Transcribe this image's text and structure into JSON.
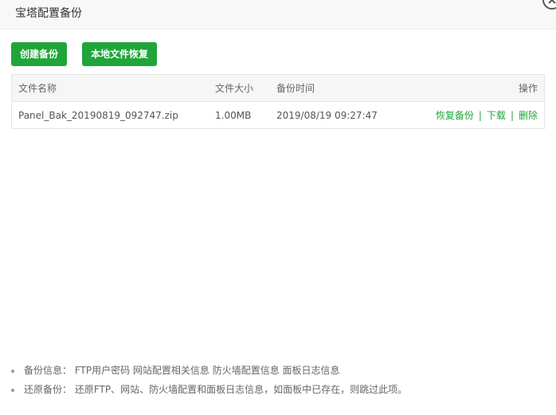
{
  "dialog": {
    "title": "宝塔配置备份",
    "close_icon": "close-icon"
  },
  "toolbar": {
    "create_label": "创建备份",
    "restore_local_label": "本地文件恢复"
  },
  "table": {
    "headers": {
      "name": "文件名称",
      "size": "文件大小",
      "time": "备份时间",
      "ops": "操作"
    },
    "rows": [
      {
        "name": "Panel_Bak_20190819_092747.zip",
        "size": "1.00MB",
        "time": "2019/08/19 09:27:47",
        "restore": "恢复备份",
        "download": "下载",
        "delete": "删除",
        "sep": "|"
      }
    ]
  },
  "notes": [
    "备份信息： FTP用户密码 网站配置相关信息 防火墙配置信息 面板日志信息",
    "还原备份： 还原FTP、网站、防火墙配置和面板日志信息，如面板中已存在，则跳过此项。"
  ],
  "colors": {
    "accent": "#20a53a",
    "header_bg": "#f8f8f8",
    "table_head_bg": "#f6f6f6"
  }
}
